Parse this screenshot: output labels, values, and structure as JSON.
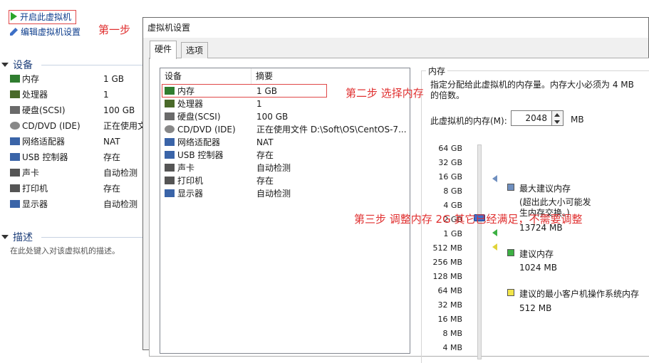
{
  "vm_panel": {
    "actions": {
      "power_on": "开启此虚拟机",
      "edit_settings": "编辑虚拟机设置"
    },
    "devices_heading": "设备",
    "devices": [
      {
        "name": "内存",
        "summary": "1 GB",
        "icon": "memory-icon"
      },
      {
        "name": "处理器",
        "summary": "1",
        "icon": "cpu-icon"
      },
      {
        "name": "硬盘(SCSI)",
        "summary": "100 GB",
        "icon": "disk-icon"
      },
      {
        "name": "CD/DVD (IDE)",
        "summary": "正在使用文件",
        "icon": "cdrom-icon"
      },
      {
        "name": "网络适配器",
        "summary": "NAT",
        "icon": "network-icon"
      },
      {
        "name": "USB 控制器",
        "summary": "存在",
        "icon": "usb-icon"
      },
      {
        "name": "声卡",
        "summary": "自动检测",
        "icon": "sound-icon"
      },
      {
        "name": "打印机",
        "summary": "存在",
        "icon": "printer-icon"
      },
      {
        "name": "显示器",
        "summary": "自动检测",
        "icon": "display-icon"
      }
    ],
    "description_heading": "描述",
    "description_placeholder": "在此处键入对该虚拟机的描述。"
  },
  "annotations": {
    "step1": "第一步",
    "step2": "第二步 选择内存",
    "step3": "第三步 调整内存 2G  其它已经满足，不需要调整"
  },
  "dialog": {
    "title": "虚拟机设置",
    "tabs": {
      "hardware": "硬件",
      "options": "选项"
    },
    "columns": {
      "device": "设备",
      "summary": "摘要"
    },
    "rows": [
      {
        "name": "内存",
        "summary": "1 GB",
        "icon": "memory-icon"
      },
      {
        "name": "处理器",
        "summary": "1",
        "icon": "cpu-icon"
      },
      {
        "name": "硬盘(SCSI)",
        "summary": "100 GB",
        "icon": "disk-icon"
      },
      {
        "name": "CD/DVD (IDE)",
        "summary": "正在使用文件 D:\\Soft\\OS\\CentOS-7...",
        "icon": "cdrom-icon"
      },
      {
        "name": "网络适配器",
        "summary": "NAT",
        "icon": "network-icon"
      },
      {
        "name": "USB 控制器",
        "summary": "存在",
        "icon": "usb-icon"
      },
      {
        "name": "声卡",
        "summary": "自动检测",
        "icon": "sound-icon"
      },
      {
        "name": "打印机",
        "summary": "存在",
        "icon": "printer-icon"
      },
      {
        "name": "显示器",
        "summary": "自动检测",
        "icon": "display-icon"
      }
    ],
    "memory": {
      "group_title": "内存",
      "description": "指定分配给此虚拟机的内存量。内存大小必须为 4 MB 的倍数。",
      "input_label": "此虚拟机的内存(M):",
      "value": "2048",
      "unit": "MB",
      "scale_labels": [
        "64 GB",
        "32 GB",
        "16 GB",
        "8 GB",
        "4 GB",
        "2 GB",
        "1 GB",
        "512 MB",
        "256 MB",
        "128 MB",
        "64 MB",
        "32 MB",
        "16 MB",
        "8 MB",
        "4 MB"
      ],
      "legend": {
        "max_recommended": {
          "label": "最大建议内存",
          "note": "(超出此大小可能发生内存交换。)",
          "value": "13724 MB",
          "color": "#6f8fbf"
        },
        "recommended": {
          "label": "建议内存",
          "value": "1024 MB",
          "color": "#3cb043"
        },
        "guest_min": {
          "label": "建议的最小客户机操作系统内存",
          "value": "512 MB",
          "color": "#f2e54a"
        }
      }
    }
  },
  "colors": {
    "annotation": "#e03030",
    "selection_box": "#e04848",
    "link": "#0d3d8c"
  }
}
